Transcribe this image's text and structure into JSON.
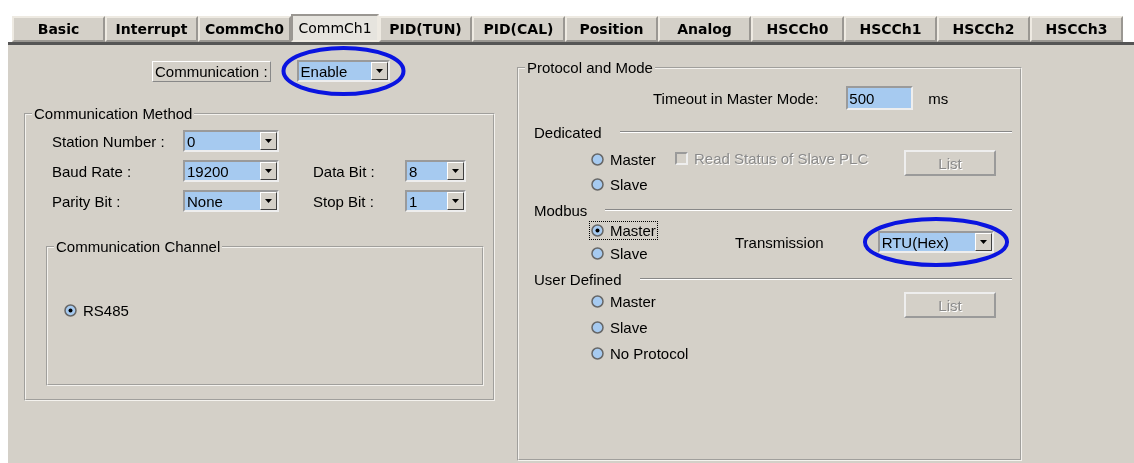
{
  "tabs": [
    {
      "label": "Basic",
      "selected": false
    },
    {
      "label": "Interrupt",
      "selected": false
    },
    {
      "label": "CommCh0",
      "selected": false
    },
    {
      "label": "CommCh1",
      "selected": true
    },
    {
      "label": "PID(TUN)",
      "selected": false
    },
    {
      "label": "PID(CAL)",
      "selected": false
    },
    {
      "label": "Position",
      "selected": false
    },
    {
      "label": "Analog",
      "selected": false
    },
    {
      "label": "HSCCh0",
      "selected": false
    },
    {
      "label": "HSCCh1",
      "selected": false
    },
    {
      "label": "HSCCh2",
      "selected": false
    },
    {
      "label": "HSCCh3",
      "selected": false
    }
  ],
  "communication": {
    "label": "Communication :",
    "value": "Enable",
    "highlighted": true
  },
  "method": {
    "title": "Communication Method",
    "rows": [
      [
        {
          "label": "Station Number :",
          "value": "0"
        }
      ],
      [
        {
          "label": "Baud Rate :",
          "value": "19200"
        },
        {
          "label": "Data Bit :",
          "value": "8"
        }
      ],
      [
        {
          "label": "Parity Bit :",
          "value": "None"
        },
        {
          "label": "Stop Bit :",
          "value": "1"
        }
      ]
    ],
    "channel": {
      "title": "Communication Channel",
      "options": [
        {
          "label": "RS485",
          "selected": true
        }
      ]
    }
  },
  "protocol": {
    "title": "Protocol and Mode",
    "timeout": {
      "label": "Timeout in Master Mode:",
      "value": "500",
      "unit": "ms"
    },
    "sections": [
      {
        "title": "Dedicated",
        "options": [
          {
            "label": "Master",
            "selected": false,
            "focused": false
          },
          {
            "label": "Slave",
            "selected": false,
            "focused": false
          }
        ],
        "checkbox": {
          "label": "Read Status of Slave PLC",
          "checked": false,
          "disabled": true
        },
        "button": {
          "label": "List",
          "disabled": true
        }
      },
      {
        "title": "Modbus",
        "options": [
          {
            "label": "Master",
            "selected": true,
            "focused": true
          },
          {
            "label": "Slave",
            "selected": false,
            "focused": false
          }
        ],
        "transmission": {
          "label": "Transmission",
          "value": "RTU(Hex)",
          "highlighted": true
        }
      },
      {
        "title": "User Defined",
        "options": [
          {
            "label": "Master",
            "selected": false,
            "focused": false
          },
          {
            "label": "Slave",
            "selected": false,
            "focused": false
          },
          {
            "label": "No Protocol",
            "selected": false,
            "focused": false
          }
        ],
        "button": {
          "label": "List",
          "disabled": true
        }
      }
    ]
  }
}
